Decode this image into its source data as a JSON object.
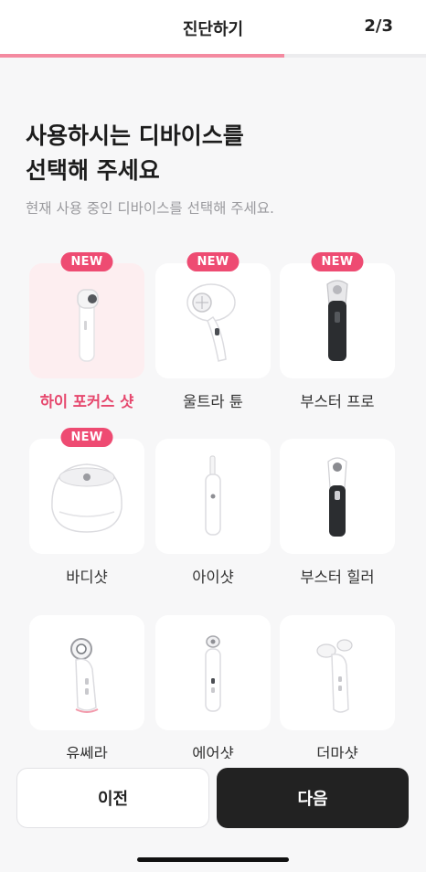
{
  "header": {
    "title": "진단하기",
    "step": "2/3"
  },
  "progress": {
    "fraction": 0.6667,
    "color": "#f48aa0"
  },
  "main": {
    "heading_line1": "사용하시는 디바이스를",
    "heading_line2": "선택해 주세요",
    "subheading": "현재 사용 중인 디바이스를 선택해 주세요."
  },
  "devices": [
    {
      "label": "하이 포커스 샷",
      "is_new": true,
      "selected": true,
      "icon": "wand-device-icon"
    },
    {
      "label": "울트라 튠",
      "is_new": true,
      "selected": false,
      "icon": "handheld-device-icon"
    },
    {
      "label": "부스터 프로",
      "is_new": true,
      "selected": false,
      "icon": "booster-pro-icon"
    },
    {
      "label": "바디샷",
      "is_new": true,
      "selected": false,
      "icon": "dome-device-icon"
    },
    {
      "label": "아이샷",
      "is_new": false,
      "selected": false,
      "icon": "pen-device-icon"
    },
    {
      "label": "부스터 힐러",
      "is_new": false,
      "selected": false,
      "icon": "booster-healer-icon"
    },
    {
      "label": "유쎄라",
      "is_new": false,
      "selected": false,
      "icon": "ultherapy-device-icon"
    },
    {
      "label": "에어샷",
      "is_new": false,
      "selected": false,
      "icon": "airshot-device-icon"
    },
    {
      "label": "더마샷",
      "is_new": false,
      "selected": false,
      "icon": "dermashot-device-icon"
    }
  ],
  "badge_text": "NEW",
  "footer": {
    "prev_label": "이전",
    "next_label": "다음"
  },
  "colors": {
    "accent": "#ee4b72",
    "selected_bg": "#fdeef0",
    "primary_button": "#222222"
  }
}
